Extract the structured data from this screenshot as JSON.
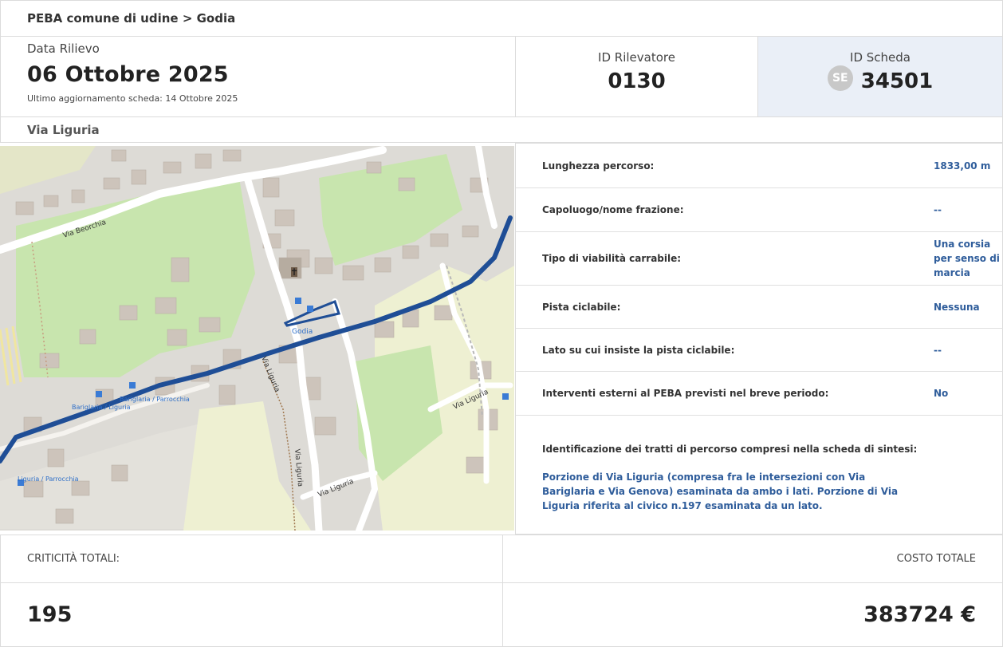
{
  "breadcrumb": "PEBA comune di udine > Godia",
  "header": {
    "date_label": "Data Rilievo",
    "date_value": "06 Ottobre 2025",
    "updated": "Ultimo aggiornamento scheda: 14 Ottobre 2025",
    "rilevatore_label": "ID Rilevatore",
    "rilevatore_value": "0130",
    "scheda_label": "ID Scheda",
    "scheda_badge": "SE",
    "scheda_value": "34501"
  },
  "street": "Via Liguria",
  "map": {
    "labels": [
      "Via Beorchia",
      "Via Liguria",
      "Via Liguria",
      "Via Liguria",
      "Via Liguria",
      "Godia",
      "Bariglaria / Parrocchia",
      "Bariglaria / Liguria",
      "Liguria / Parrocchia"
    ],
    "colors": {
      "route": "#1f4e96",
      "green": "#c8e5ae",
      "building": "#cdc4bb",
      "road": "#ffffff",
      "land": "#dddbd6",
      "field": "#eef0d2"
    }
  },
  "info": [
    {
      "key": "Lunghezza percorso:",
      "value": "1833,00 m"
    },
    {
      "key": "Capoluogo/nome frazione:",
      "value": "--"
    },
    {
      "key": "Tipo di viabilità carrabile:",
      "value": "Una corsia per senso di marcia"
    },
    {
      "key": "Pista ciclabile:",
      "value": "Nessuna"
    },
    {
      "key": "Lato su cui insiste la pista ciclabile:",
      "value": "--"
    },
    {
      "key": "Interventi esterni al PEBA previsti nel breve periodo:",
      "value": "No"
    }
  ],
  "identification": {
    "title": "Identificazione dei tratti di percorso compresi nella scheda di sintesi:",
    "description": "Porzione di Via Liguria (compresa fra le intersezioni con Via Bariglaria e Via Genova) esaminata da ambo i lati. Porzione di Via Liguria riferita al civico n.197 esaminata da un lato."
  },
  "totals": {
    "criticita_label": "CRITICITÀ TOTALI:",
    "criticita_value": "195",
    "costo_label": "COSTO TOTALE",
    "costo_value": "383724 €"
  }
}
